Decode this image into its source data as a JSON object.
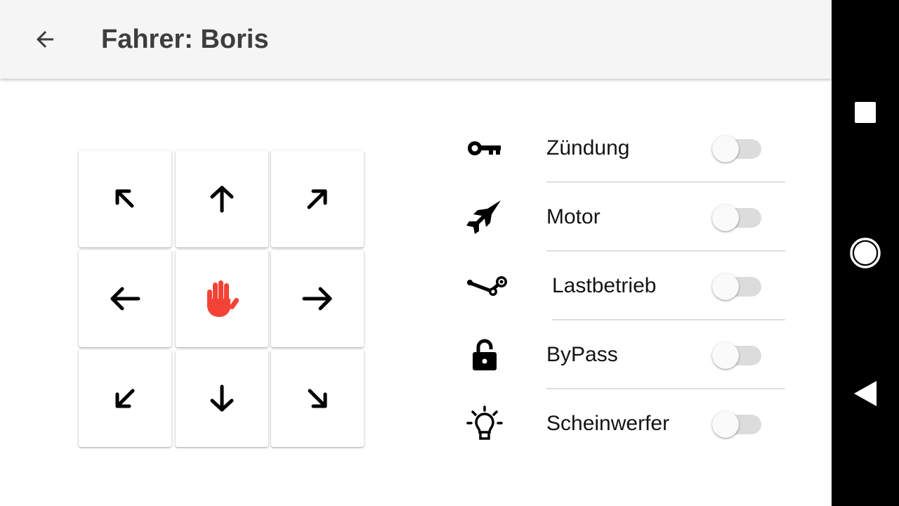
{
  "app_bar": {
    "back_icon": "arrow-left-icon",
    "title": "Fahrer: Boris"
  },
  "direction_pad": {
    "buttons": [
      {
        "name": "up-left",
        "icon": "arrow-up-left-icon"
      },
      {
        "name": "up",
        "icon": "arrow-up-icon"
      },
      {
        "name": "up-right",
        "icon": "arrow-up-right-icon"
      },
      {
        "name": "left",
        "icon": "arrow-left-icon"
      },
      {
        "name": "stop",
        "icon": "hand-stop-icon",
        "color": "#f44336"
      },
      {
        "name": "right",
        "icon": "arrow-right-icon"
      },
      {
        "name": "down-left",
        "icon": "arrow-down-left-icon"
      },
      {
        "name": "down",
        "icon": "arrow-down-icon"
      },
      {
        "name": "down-right",
        "icon": "arrow-down-right-icon"
      }
    ]
  },
  "controls": [
    {
      "label": "Zündung",
      "icon": "key-icon",
      "on": false
    },
    {
      "label": "Motor",
      "icon": "jet-icon",
      "on": false
    },
    {
      "label": "Lastbetrieb",
      "icon": "steam-icon",
      "on": false
    },
    {
      "label": "ByPass",
      "icon": "lock-open-icon",
      "on": false
    },
    {
      "label": "Scheinwerfer",
      "icon": "lightbulb-icon",
      "on": false
    }
  ],
  "system_nav": {
    "recents_icon": "square-icon",
    "home_icon": "circle-icon",
    "back_icon": "triangle-back-icon"
  },
  "colors": {
    "app_bar_background": "#f5f5f5",
    "title_text": "#3d3d3d",
    "stop_hand": "#f44336",
    "switch_track_off": "#dcdcdc",
    "switch_thumb_off": "#fafafa",
    "nav_bar": "#000000"
  }
}
